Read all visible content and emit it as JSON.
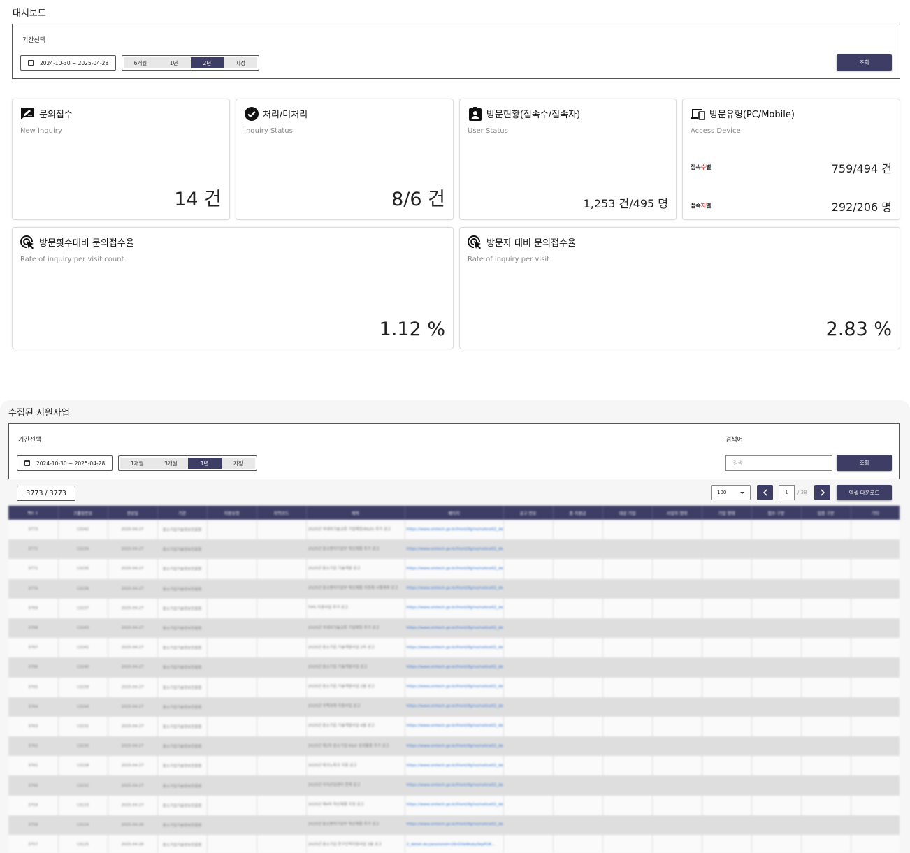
{
  "dashboard": {
    "title": "대시보드",
    "filter": {
      "label": "기간선택",
      "date_range": "2024-10-30 ~ 2025-04-28",
      "periods": [
        "6개월",
        "1년",
        "2년",
        "지정"
      ],
      "active_period": "2년",
      "search_button": "조회"
    },
    "cards": {
      "new_inquiry": {
        "title": "문의접수",
        "subtitle": "New Inquiry",
        "value": "14 건"
      },
      "inquiry_status": {
        "title": "처리/미처리",
        "subtitle": "Inquiry Status",
        "value": "8/6 건"
      },
      "user_status": {
        "title": "방문현황(접속수/접속자)",
        "subtitle": "User Status",
        "value": "1,253 건/495 명"
      },
      "access_device": {
        "title": "방문유형(PC/Mobile)",
        "subtitle": "Access Device",
        "rows": [
          {
            "label_prefix": "접속",
            "label_highlight": "수",
            "label_suffix": "별",
            "value": "759/494 건"
          },
          {
            "label_prefix": "접속",
            "label_highlight": "자",
            "label_suffix": "별",
            "value": "292/206 명"
          }
        ]
      },
      "rate_visit_count": {
        "title": "방문횟수대비 문의접수율",
        "subtitle": "Rate of inquiry per visit count",
        "value": "1.12 %"
      },
      "rate_visitor": {
        "title": "방문자 대비 문의접수율",
        "subtitle": "Rate of inquiry per visit",
        "value": "2.83 %"
      }
    }
  },
  "programs": {
    "title": "수집된 지원사업",
    "filter": {
      "label": "기간선택",
      "date_range": "2024-10-30 ~ 2025-04-28",
      "periods": [
        "1개월",
        "3개월",
        "1년",
        "지정"
      ],
      "active_period": "1년",
      "keyword_label": "검색어",
      "keyword_placeholder": "검색",
      "search_button": "조회"
    },
    "count": "3773 / 3773",
    "page_size": "100",
    "current_page": "1",
    "total_pages": "/ 38",
    "excel_button": "엑셀 다운로드",
    "columns": [
      "No ↓",
      "크롤링번호",
      "생성일",
      "기관",
      "지원유형",
      "지역코드",
      "제목",
      "페이지",
      "공고 번호",
      "총 지원금",
      "대상 기업",
      "사업자 형태",
      "기업 형태",
      "접수 구분",
      "업종 구분",
      "기타"
    ],
    "rows": [
      {
        "no": "3773",
        "crawl": "13242",
        "date": "2025-04-27",
        "org": "중소기업기술정보진흥원",
        "title": "2025년 국내외기술교류 기업매칭(R&D) 추가 공고",
        "url": "https://www.smtech.go.kr/front/ifg/no/notice02_detail.do;jsessionid=DmcA5ID..."
      },
      {
        "no": "3772",
        "crawl": "13234",
        "date": "2025-04-27",
        "org": "중소기업기술정보진흥원",
        "title": "2025년 중소벤처기업부 혁신제품 추가 공고",
        "url": "https://www.smtech.go.kr/front/ifg/no/notice02_detail.do;jsessionid=DmcA5ID..."
      },
      {
        "no": "3771",
        "crawl": "13235",
        "date": "2025-04-27",
        "org": "중소기업기술정보진흥원",
        "title": "2025년 중소기업 기술개발 공고",
        "url": "https://www.smtech.go.kr/front/ifg/no/notice02_detail.do;jsessionid=DmcA5ID..."
      },
      {
        "no": "3770",
        "crawl": "13236",
        "date": "2025-04-27",
        "org": "중소기업기술정보진흥원",
        "title": "2025년 중소벤처기업부 혁신제품 지정제 시행계획 공고",
        "url": "https://www.smtech.go.kr/front/ifg/no/notice02_detail.do;jsessionid=DmcA5ID..."
      },
      {
        "no": "3769",
        "crawl": "13237",
        "date": "2025-04-27",
        "org": "중소기업기술정보진흥원",
        "title": "TIPS 지원사업 추가 공고",
        "url": "https://www.smtech.go.kr/front/ifg/no/notice02_detail.do;jsessionid=DmcA5ID..."
      },
      {
        "no": "3768",
        "crawl": "13243",
        "date": "2025-04-27",
        "org": "중소기업기술정보진흥원",
        "title": "2025년 국내외기술교류 기업매칭 추가 공고",
        "url": "https://www.smtech.go.kr/front/ifg/no/notice02_detail.do;jsessionid=DmcA5ID..."
      },
      {
        "no": "3767",
        "crawl": "13241",
        "date": "2025-04-27",
        "org": "중소기업기술정보진흥원",
        "title": "2025년 중소기업 기술개발사업 2차 공고",
        "url": "https://www.smtech.go.kr/front/ifg/no/notice02_detail.do;jsessionid=DmcA5ID..."
      },
      {
        "no": "3766",
        "crawl": "13240",
        "date": "2025-04-27",
        "org": "중소기업기술정보진흥원",
        "title": "2025년 중소기업 기술개발사업 공고",
        "url": "https://www.smtech.go.kr/front/ifg/no/notice02_detail.do;jsessionid=DmcA5ID..."
      },
      {
        "no": "3765",
        "crawl": "13239",
        "date": "2025-04-27",
        "org": "중소기업기술정보진흥원",
        "title": "2025년 중소기업 기술개발사업 2월 공고",
        "url": "https://www.smtech.go.kr/front/ifg/no/notice02_detail.do;jsessionid=DmcA5ID..."
      },
      {
        "no": "3764",
        "crawl": "13244",
        "date": "2025-04-27",
        "org": "중소기업기술정보진흥원",
        "title": "2025년 국책과제 지원사업 공고",
        "url": "https://www.smtech.go.kr/front/ifg/no/notice02_detail.do;jsessionid=DmcA5ID..."
      },
      {
        "no": "3763",
        "crawl": "13231",
        "date": "2025-04-27",
        "org": "중소기업기술정보진흥원",
        "title": "2025년 중소기업 기술개발사업 4월 공고",
        "url": "https://www.smtech.go.kr/front/ifg/no/notice02_detail.do;jsessionid=DmcA5ID..."
      },
      {
        "no": "3762",
        "crawl": "13230",
        "date": "2025-04-27",
        "org": "중소기업기술정보진흥원",
        "title": "2025년 제2차 중소기업 R&D 성과활용 추가 공고",
        "url": "https://www.smtech.go.kr/front/ifg/no/notice02_detail.do;jsessionid=DmcA5ID..."
      },
      {
        "no": "3761",
        "crawl": "13228",
        "date": "2025-04-27",
        "org": "중소기업기술정보진흥원",
        "title": "2025년 테크노파크 지원 공고",
        "url": "https://www.smtech.go.kr/front/ifg/no/notice02_detail.do;jsessionid=DmcA5ID..."
      },
      {
        "no": "3760",
        "crawl": "13232",
        "date": "2025-04-27",
        "org": "중소기업기술정보진흥원",
        "title": "2025년 지식산업센터 연계 공고",
        "url": "https://www.smtech.go.kr/front/ifg/no/notice02_detail.do;jsessionid=DmcA5ID..."
      },
      {
        "no": "3759",
        "crawl": "13133",
        "date": "2025-04-27",
        "org": "중소기업기술정보진흥원",
        "title": "2025년 제4차 혁신제품 지정 공고",
        "url": "https://www.smtech.go.kr/front/ifg/no/notice02_detail.do;jsessionid=DmcA5ID..."
      },
      {
        "no": "3758",
        "crawl": "13124",
        "date": "2025-04-26",
        "org": "중소기업기술정보진흥원",
        "title": "2025년 중소벤처기업부 혁신제품 추가 공고",
        "url": "https://www.smtech.go.kr/front/ifg/no/notice02_detail.do;jsessionid=16nGVaWuby..."
      },
      {
        "no": "3757",
        "crawl": "13125",
        "date": "2025-04-26",
        "org": "중소기업기술정보진흥원",
        "title": "2025년 중소기업 연구인력지원사업 3월 공고",
        "url": "2_detail.do;jsessionid=16nGVaWubySkpPUK..."
      }
    ]
  }
}
